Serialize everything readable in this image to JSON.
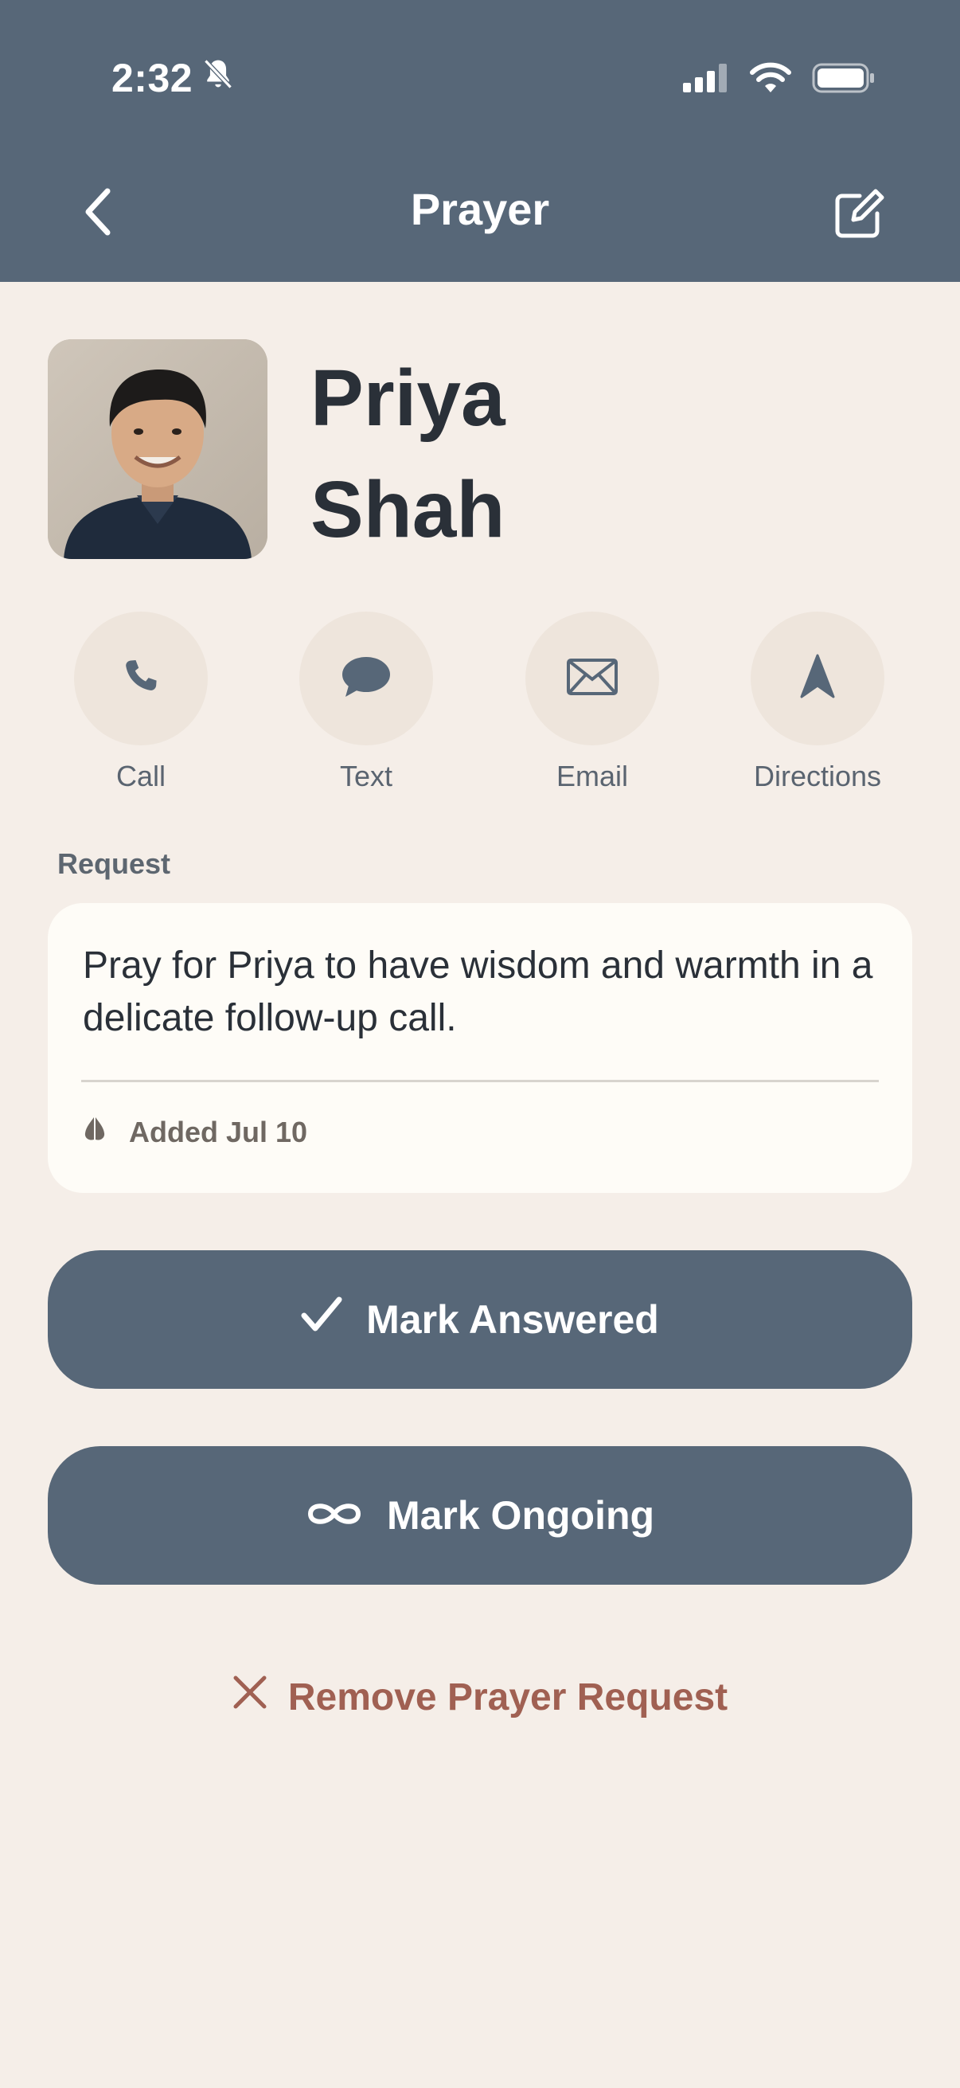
{
  "status_bar": {
    "time": "2:32",
    "icons": [
      "bell-slash-icon",
      "signal-icon",
      "wifi-icon",
      "battery-icon"
    ]
  },
  "nav": {
    "title": "Prayer",
    "back_icon": "chevron-left-icon",
    "edit_icon": "edit-square-icon"
  },
  "profile": {
    "first_name": "Priya",
    "last_name": "Shah"
  },
  "actions": [
    {
      "label": "Call",
      "icon": "phone-icon"
    },
    {
      "label": "Text",
      "icon": "chat-bubble-icon"
    },
    {
      "label": "Email",
      "icon": "envelope-icon"
    },
    {
      "label": "Directions",
      "icon": "navigation-arrow-icon"
    }
  ],
  "request": {
    "section_label": "Request",
    "text": "Pray for Priya to have wisdom and warmth in a delicate follow-up call.",
    "added": "Added Jul 10",
    "added_icon": "praying-hands-icon"
  },
  "buttons": {
    "answered": "Mark Answered",
    "ongoing": "Mark Ongoing",
    "remove": "Remove Prayer Request"
  },
  "colors": {
    "header": "#576778",
    "background": "#F5EEE8",
    "card": "#FEFCF7",
    "action_circle": "#EEE5DC",
    "remove_text": "#A06052"
  }
}
